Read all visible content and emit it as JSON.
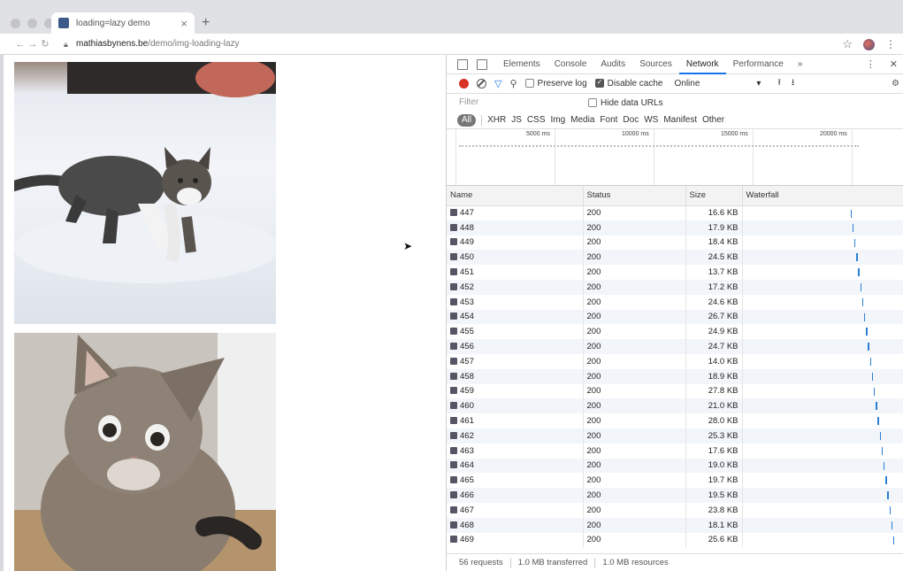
{
  "browser": {
    "tab_title": "loading=lazy demo",
    "new_tab": "+",
    "close": "×",
    "url_host": "mathiasbynens.be",
    "url_path": "/demo/img-loading-lazy"
  },
  "devtools": {
    "tabs": [
      "Elements",
      "Console",
      "Audits",
      "Sources",
      "Network",
      "Performance",
      "»"
    ],
    "active_tab": "Network",
    "preserve_log": "Preserve log",
    "disable_cache": "Disable cache",
    "throttle": "Online",
    "filter_placeholder": "Filter",
    "hide_data_urls": "Hide data URLs",
    "types": [
      "All",
      "XHR",
      "JS",
      "CSS",
      "Img",
      "Media",
      "Font",
      "Doc",
      "WS",
      "Manifest",
      "Other"
    ],
    "timeline_ticks": [
      "5000 ms",
      "10000 ms",
      "15000 ms",
      "20000 ms"
    ],
    "columns": [
      "Name",
      "Status",
      "Size",
      "Waterfall"
    ],
    "rows": [
      {
        "name": "447",
        "status": "200",
        "size": "16.6 KB"
      },
      {
        "name": "448",
        "status": "200",
        "size": "17.9 KB"
      },
      {
        "name": "449",
        "status": "200",
        "size": "18.4 KB"
      },
      {
        "name": "450",
        "status": "200",
        "size": "24.5 KB"
      },
      {
        "name": "451",
        "status": "200",
        "size": "13.7 KB"
      },
      {
        "name": "452",
        "status": "200",
        "size": "17.2 KB"
      },
      {
        "name": "453",
        "status": "200",
        "size": "24.6 KB"
      },
      {
        "name": "454",
        "status": "200",
        "size": "26.7 KB"
      },
      {
        "name": "455",
        "status": "200",
        "size": "24.9 KB"
      },
      {
        "name": "456",
        "status": "200",
        "size": "24.7 KB"
      },
      {
        "name": "457",
        "status": "200",
        "size": "14.0 KB"
      },
      {
        "name": "458",
        "status": "200",
        "size": "18.9 KB"
      },
      {
        "name": "459",
        "status": "200",
        "size": "27.8 KB"
      },
      {
        "name": "460",
        "status": "200",
        "size": "21.0 KB"
      },
      {
        "name": "461",
        "status": "200",
        "size": "28.0 KB"
      },
      {
        "name": "462",
        "status": "200",
        "size": "25.3 KB"
      },
      {
        "name": "463",
        "status": "200",
        "size": "17.6 KB"
      },
      {
        "name": "464",
        "status": "200",
        "size": "19.0 KB"
      },
      {
        "name": "465",
        "status": "200",
        "size": "19.7 KB"
      },
      {
        "name": "466",
        "status": "200",
        "size": "19.5 KB"
      },
      {
        "name": "467",
        "status": "200",
        "size": "23.8 KB"
      },
      {
        "name": "468",
        "status": "200",
        "size": "18.1 KB"
      },
      {
        "name": "469",
        "status": "200",
        "size": "25.6 KB"
      }
    ],
    "status": {
      "requests": "56 requests",
      "transferred": "1.0 MB transferred",
      "resources": "1.0 MB resources"
    }
  },
  "colors": {
    "record": "#d93025",
    "accent": "#1a73e8",
    "waterfall": "#2a7fd4"
  }
}
